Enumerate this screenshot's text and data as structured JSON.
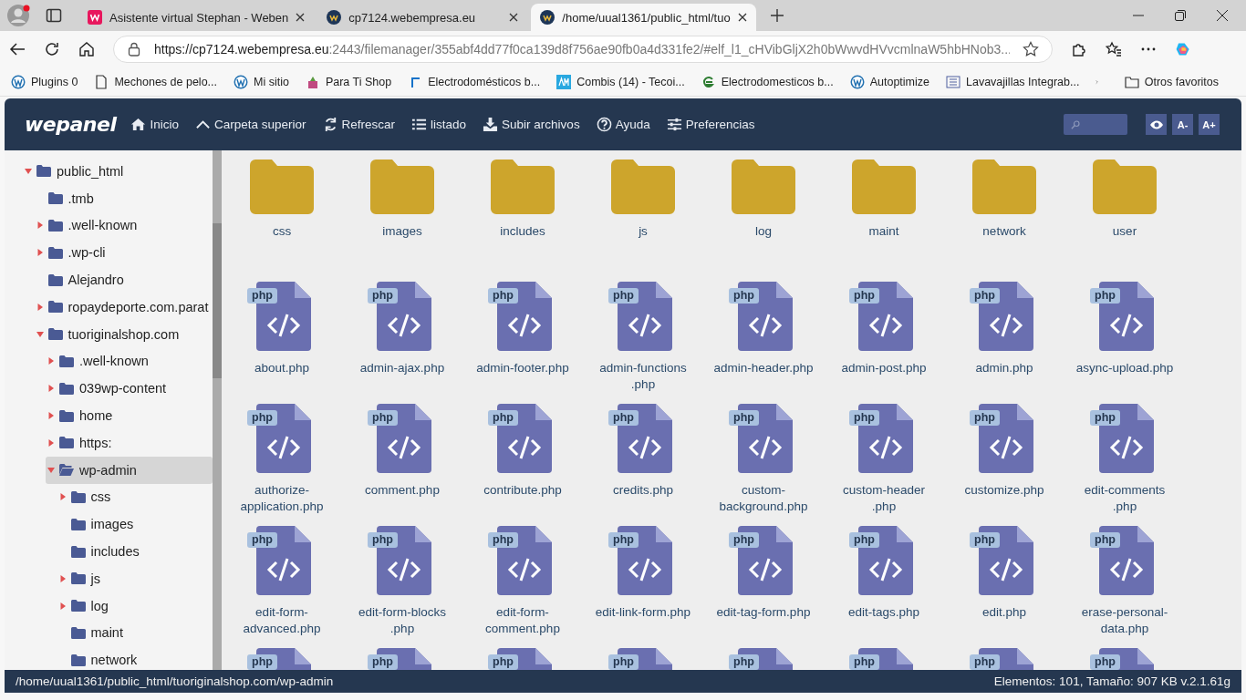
{
  "browser": {
    "tabs": [
      {
        "title": "Asistente virtual Stephan - Weben",
        "selected": false,
        "kind": "w"
      },
      {
        "title": "cp7124.webempresa.eu",
        "selected": false,
        "kind": "wp"
      },
      {
        "title": "/home/uual1361/public_html/tuo",
        "selected": true,
        "kind": "wp"
      }
    ],
    "url_host": "https://cp7124.webempresa.eu",
    "url_rest": ":2443/filemanager/355abf4dd77f0ca139d8f756ae90fb0a4d331fe2/#elf_l1_cHVibGljX2h0bWwvdHVvcmlnaW5hbHNob3...",
    "bookmarks": [
      {
        "label": "Plugins 0",
        "kind": "wp"
      },
      {
        "label": "Mechones de pelo...",
        "kind": "page"
      },
      {
        "label": "Mi sitio",
        "kind": "wp"
      },
      {
        "label": "Para Ti Shop",
        "kind": "gift"
      },
      {
        "label": "Electrodomésticos b...",
        "kind": "bracket"
      },
      {
        "label": "Combis (14) - Tecoi...",
        "kind": "am"
      },
      {
        "label": "Electrodomesticos b...",
        "kind": "e"
      },
      {
        "label": "Autoptimize",
        "kind": "wp"
      },
      {
        "label": "Lavavajillas Integrab...",
        "kind": "grid"
      }
    ],
    "other_bookmarks": "Otros favoritos"
  },
  "app": {
    "logo": "wepanel",
    "toolbar": [
      {
        "label": "Inicio",
        "kind": "home"
      },
      {
        "label": "Carpeta superior",
        "kind": "up"
      },
      {
        "label": "Refrescar",
        "kind": "refresh"
      },
      {
        "label": "listado",
        "kind": "list"
      },
      {
        "label": "Subir archivos",
        "kind": "upload"
      },
      {
        "label": "Ayuda",
        "kind": "help"
      },
      {
        "label": "Preferencias",
        "kind": "prefs"
      }
    ],
    "font_buttons": [
      "A-",
      "A+"
    ],
    "tree": [
      {
        "name": "public_html",
        "kind": "open",
        "selected": false,
        "children": [
          {
            "name": ".tmb",
            "kind": "leaf",
            "selected": false
          },
          {
            "name": ".well-known",
            "kind": "closed",
            "selected": false
          },
          {
            "name": ".wp-cli",
            "kind": "closed",
            "selected": false
          },
          {
            "name": "Alejandro",
            "kind": "leaf",
            "selected": false
          },
          {
            "name": "ropaydeporte.com.parat",
            "kind": "closed",
            "selected": false
          },
          {
            "name": "tuoriginalshop.com",
            "kind": "open",
            "selected": false,
            "children": [
              {
                "name": ".well-known",
                "kind": "closed",
                "selected": false
              },
              {
                "name": "039wp-content",
                "kind": "closed",
                "selected": false
              },
              {
                "name": "home",
                "kind": "closed",
                "selected": false
              },
              {
                "name": "https:",
                "kind": "closed",
                "selected": false
              },
              {
                "name": "wp-admin",
                "kind": "open",
                "selected": true,
                "children": [
                  {
                    "name": "css",
                    "kind": "closed",
                    "selected": false
                  },
                  {
                    "name": "images",
                    "kind": "leaf",
                    "selected": false
                  },
                  {
                    "name": "includes",
                    "kind": "leaf",
                    "selected": false
                  },
                  {
                    "name": "js",
                    "kind": "closed",
                    "selected": false
                  },
                  {
                    "name": "log",
                    "kind": "closed",
                    "selected": false
                  },
                  {
                    "name": "maint",
                    "kind": "leaf",
                    "selected": false
                  },
                  {
                    "name": "network",
                    "kind": "leaf",
                    "selected": false
                  }
                ]
              }
            ]
          }
        ]
      }
    ],
    "files": [
      {
        "kind": "folder",
        "name": "css"
      },
      {
        "kind": "folder",
        "name": "images"
      },
      {
        "kind": "folder",
        "name": "includes"
      },
      {
        "kind": "folder",
        "name": "js"
      },
      {
        "kind": "folder",
        "name": "log"
      },
      {
        "kind": "folder",
        "name": "maint"
      },
      {
        "kind": "folder",
        "name": "network"
      },
      {
        "kind": "folder",
        "name": "user"
      },
      {
        "kind": "php",
        "badge": "php",
        "name": "about.php"
      },
      {
        "kind": "php",
        "badge": "php",
        "name": "admin-ajax.php"
      },
      {
        "kind": "php",
        "badge": "php",
        "name": "admin-footer.php"
      },
      {
        "kind": "php",
        "badge": "php",
        "name": "admin-functions\n.php"
      },
      {
        "kind": "php",
        "badge": "php",
        "name": "admin-header.php"
      },
      {
        "kind": "php",
        "badge": "php",
        "name": "admin-post.php"
      },
      {
        "kind": "php",
        "badge": "php",
        "name": "admin.php"
      },
      {
        "kind": "php",
        "badge": "php",
        "name": "async-upload.php"
      },
      {
        "kind": "php",
        "badge": "php",
        "name": "authorize-application.php"
      },
      {
        "kind": "php",
        "badge": "php",
        "name": "comment.php"
      },
      {
        "kind": "php",
        "badge": "php",
        "name": "contribute.php"
      },
      {
        "kind": "php",
        "badge": "php",
        "name": "credits.php"
      },
      {
        "kind": "php",
        "badge": "php",
        "name": "custom-background.php"
      },
      {
        "kind": "php",
        "badge": "php",
        "name": "custom-header\n.php"
      },
      {
        "kind": "php",
        "badge": "php",
        "name": "customize.php"
      },
      {
        "kind": "php",
        "badge": "php",
        "name": "edit-comments\n.php"
      },
      {
        "kind": "php",
        "badge": "php",
        "name": "edit-form-advanced.php"
      },
      {
        "kind": "php",
        "badge": "php",
        "name": "edit-form-blocks\n.php"
      },
      {
        "kind": "php",
        "badge": "php",
        "name": "edit-form-comment.php"
      },
      {
        "kind": "php",
        "badge": "php",
        "name": "edit-link-form.php"
      },
      {
        "kind": "php",
        "badge": "php",
        "name": "edit-tag-form.php"
      },
      {
        "kind": "php",
        "badge": "php",
        "name": "edit-tags.php"
      },
      {
        "kind": "php",
        "badge": "php",
        "name": "edit.php"
      },
      {
        "kind": "php",
        "badge": "php",
        "name": "erase-personal-data.php"
      },
      {
        "kind": "php",
        "badge": "php"
      },
      {
        "kind": "php",
        "badge": "php"
      },
      {
        "kind": "php",
        "badge": "php"
      },
      {
        "kind": "php",
        "badge": "php"
      },
      {
        "kind": "php",
        "badge": "php"
      },
      {
        "kind": "php",
        "badge": "php"
      },
      {
        "kind": "php",
        "badge": "php"
      },
      {
        "kind": "php",
        "badge": "php"
      }
    ],
    "status_path": "/home/uual1361/public_html/tuoriginalshop.com/wp-admin",
    "status_info": "Elementos: 101, Tamaño: 907 KB v.2.1.61g"
  }
}
